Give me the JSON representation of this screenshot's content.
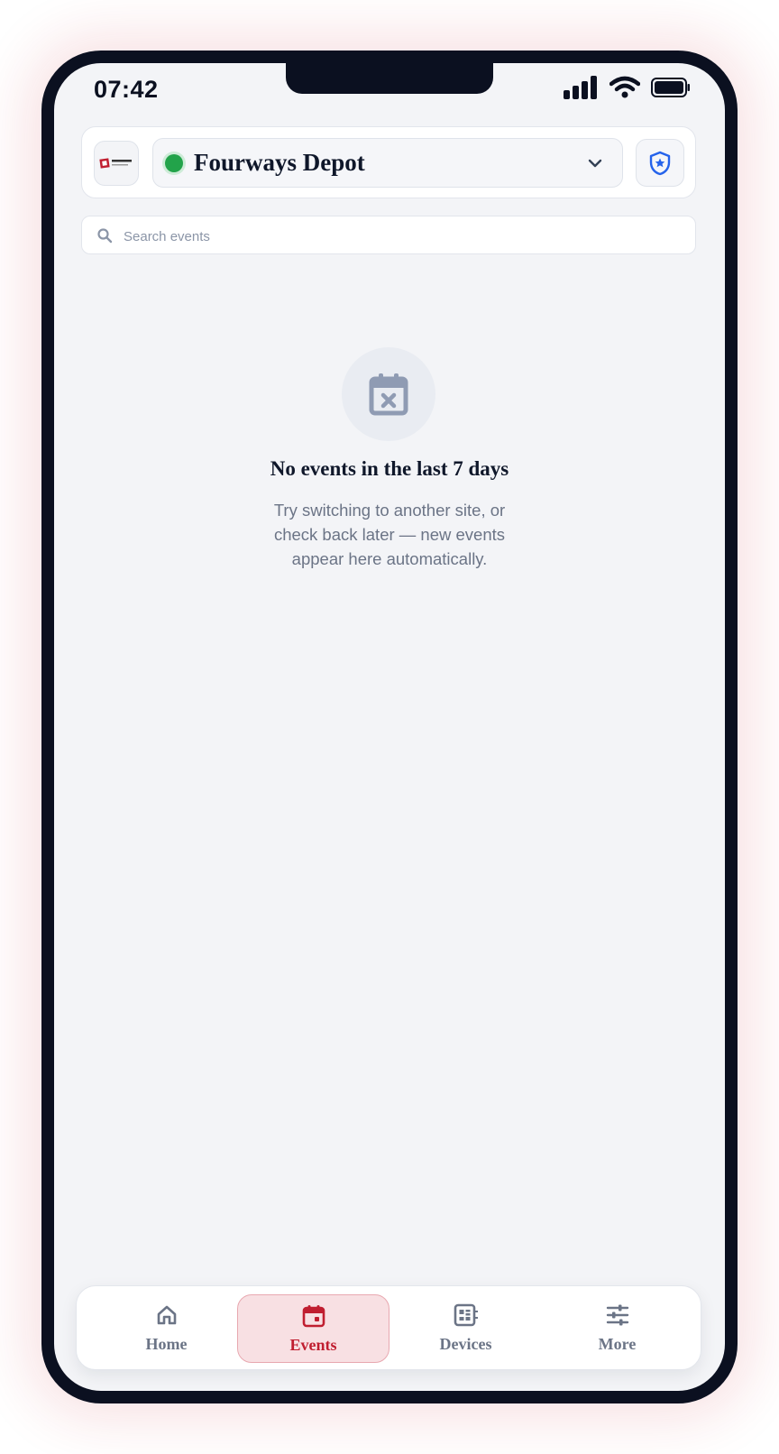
{
  "status_bar": {
    "time": "07:42"
  },
  "header": {
    "site_name": "Fourways Depot"
  },
  "search": {
    "placeholder": "Search events"
  },
  "empty_state": {
    "title": "No events in the last 7 days",
    "message": "Try switching to another site, or check back later — new events appear here automatically."
  },
  "tabs": [
    {
      "label": "Home",
      "icon": "home-icon"
    },
    {
      "label": "Events",
      "icon": "calendar-icon",
      "active": true
    },
    {
      "label": "Devices",
      "icon": "devices-icon"
    },
    {
      "label": "More",
      "icon": "sliders-icon"
    }
  ],
  "colors": {
    "accent": "#c01e30",
    "status_online": "#22a34a",
    "shield": "#2563eb"
  }
}
